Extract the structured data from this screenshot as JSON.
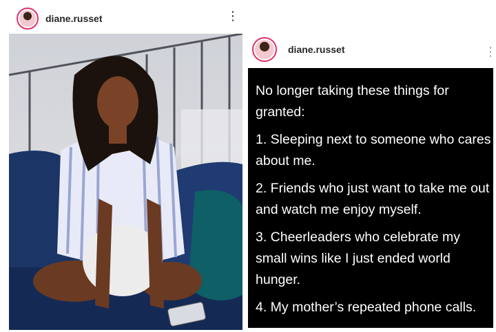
{
  "left_post": {
    "username": "diane.russet",
    "more_icon": "more-vertical-icon"
  },
  "right_post": {
    "username": "diane.russet",
    "more_icon": "more-vertical-icon",
    "card_background": "#000000",
    "card_text_color": "#ffffff",
    "lines": [
      "No longer taking these things for granted:",
      "1. Sleeping next to someone who cares about me.",
      "2. Friends who just want to take me out and watch me enjoy myself.",
      "3. Cheerleaders who celebrate my small wins like I just ended world hunger.",
      "4. My mother’s repeated phone calls."
    ]
  },
  "colors": {
    "avatar_ring": "#e1306c",
    "sofa_blue": "#1b3566",
    "shirt_stripe": "#9aa6d2"
  }
}
